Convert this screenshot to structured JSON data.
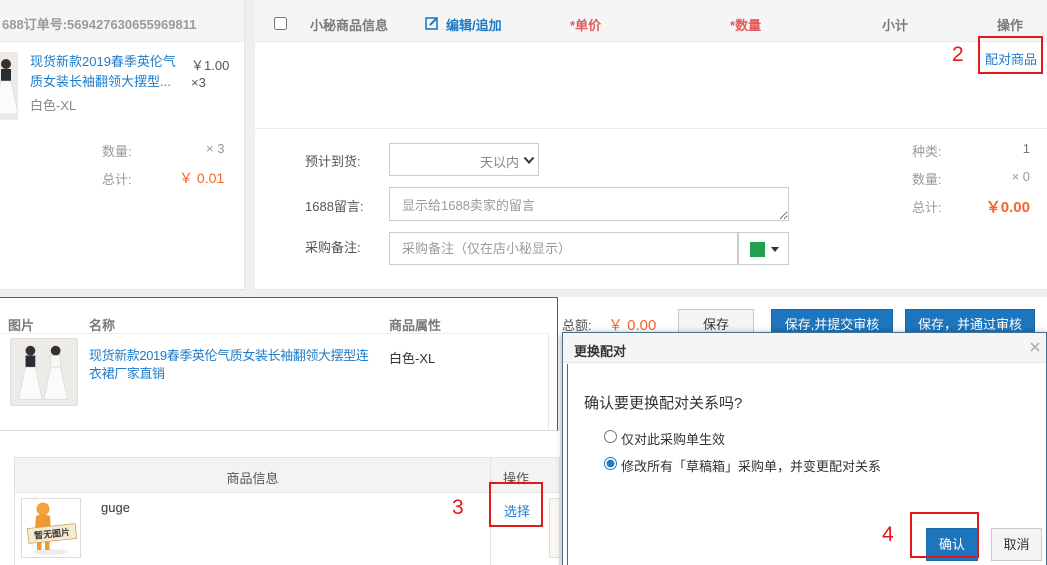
{
  "order_card": {
    "order_no": "688订单号:569427630655969811",
    "product": {
      "image_icon": "product-photo",
      "title_lines": [
        "现货新款2019春季英伦气",
        "质女装长袖翻领大摆型..."
      ],
      "price": "￥1.00",
      "qty": "×3",
      "sku": "白色-XL"
    },
    "summary": {
      "qty_label": "数量:",
      "qty_value": "× 3",
      "total_label": "总计:",
      "total_value": "￥ 0.01"
    }
  },
  "purchase_card": {
    "header": {
      "product_info": "小秘商品信息",
      "edit_icon": "edit-icon",
      "edit": "编辑/追加",
      "required_mark": "*",
      "unit_price": "单价",
      "quantity": "数量",
      "subtotal": "小计",
      "action": "操作"
    },
    "pair_link": "配对商品",
    "form": {
      "eta_label": "预计到货:",
      "eta_value": "天以内",
      "message_label": "1688留言:",
      "message_placeholder": "显示给1688卖家的留言",
      "note_label": "采购备注:",
      "note_placeholder": "采购备注（仅在店小秘显示）",
      "note_color": "#1ea24b"
    },
    "stats": {
      "kinds_label": "种类:",
      "kinds_value": "1",
      "qty_label": "数量:",
      "qty_value": "× 0",
      "total_label": "总计:",
      "total_value": "￥0.00"
    }
  },
  "action_bar": {
    "total_label": "总额:",
    "total_value": "￥ 0.00",
    "buttons": [
      "保存",
      "保存,并提交审核",
      "保存，并通过审核"
    ]
  },
  "source_popup": {
    "columns": [
      "图片",
      "名称",
      "商品属性"
    ],
    "item": {
      "title_lines": [
        "现货新款2019春季英伦气质女装长袖翻领大摆型连",
        "衣裙厂家直销"
      ],
      "sku": "白色-XL"
    }
  },
  "candidate_table": {
    "columns": [
      "商品信息",
      "操作"
    ],
    "rows": [
      {
        "image_text": "暂无图片",
        "name": "guge",
        "action": "选择"
      }
    ]
  },
  "modal": {
    "title": "更换配对",
    "close_icon": "close-icon",
    "question": "确认要更换配对关系吗?",
    "options": [
      {
        "label": "仅对此采购单生效",
        "checked": false
      },
      {
        "label": "修改所有「草稿箱」采购单，并变更配对关系",
        "checked": true
      }
    ],
    "confirm": "确认",
    "cancel": "取消"
  },
  "annotations": {
    "step2": "2",
    "step3": "3",
    "step4": "4"
  },
  "colors": {
    "link": "#1e7bc8",
    "price": "#f5642a",
    "primary_button": "#1d75bd",
    "required": "#e15b5b",
    "annotation": "#e1191b"
  }
}
